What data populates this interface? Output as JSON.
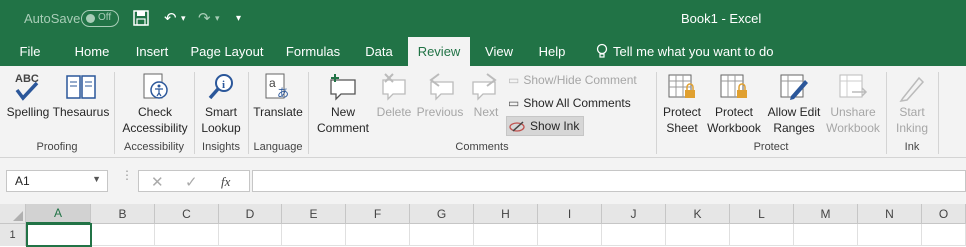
{
  "titlebar": {
    "autosave_label": "AutoSave",
    "autosave_state": "Off",
    "doc_title": "Book1  -  Excel"
  },
  "tabs": [
    {
      "label": "File"
    },
    {
      "label": "Home"
    },
    {
      "label": "Insert"
    },
    {
      "label": "Page Layout"
    },
    {
      "label": "Formulas"
    },
    {
      "label": "Data"
    },
    {
      "label": "Review",
      "active": true
    },
    {
      "label": "View"
    },
    {
      "label": "Help"
    }
  ],
  "tellme": "Tell me what you want to do",
  "ribbon": {
    "proofing": {
      "group": "Proofing",
      "spelling": "Spelling",
      "thesaurus": "Thesaurus"
    },
    "accessibility": {
      "group": "Accessibility",
      "check_l1": "Check",
      "check_l2": "Accessibility"
    },
    "insights": {
      "group": "Insights",
      "smart_l1": "Smart",
      "smart_l2": "Lookup"
    },
    "language": {
      "group": "Language",
      "translate": "Translate"
    },
    "comments": {
      "group": "Comments",
      "new_l1": "New",
      "new_l2": "Comment",
      "delete": "Delete",
      "previous": "Previous",
      "next": "Next",
      "show_hide": "Show/Hide Comment",
      "show_all": "Show All Comments",
      "show_ink": "Show Ink"
    },
    "protect": {
      "group": "Protect",
      "sheet_l1": "Protect",
      "sheet_l2": "Sheet",
      "workbook_l1": "Protect",
      "workbook_l2": "Workbook",
      "allow_l1": "Allow Edit",
      "allow_l2": "Ranges",
      "unshare_l1": "Unshare",
      "unshare_l2": "Workbook"
    },
    "ink": {
      "group": "Ink",
      "start_l1": "Start",
      "start_l2": "Inking"
    }
  },
  "formula_bar": {
    "name_box": "A1",
    "fx": "fx",
    "formula": ""
  },
  "columns": [
    "A",
    "B",
    "C",
    "D",
    "E",
    "F",
    "G",
    "H",
    "I",
    "J",
    "K",
    "L",
    "M",
    "N",
    "O"
  ],
  "rows": [
    "1"
  ],
  "colors": {
    "brand": "#217346",
    "ribbon_bg": "#f3f3f3"
  }
}
